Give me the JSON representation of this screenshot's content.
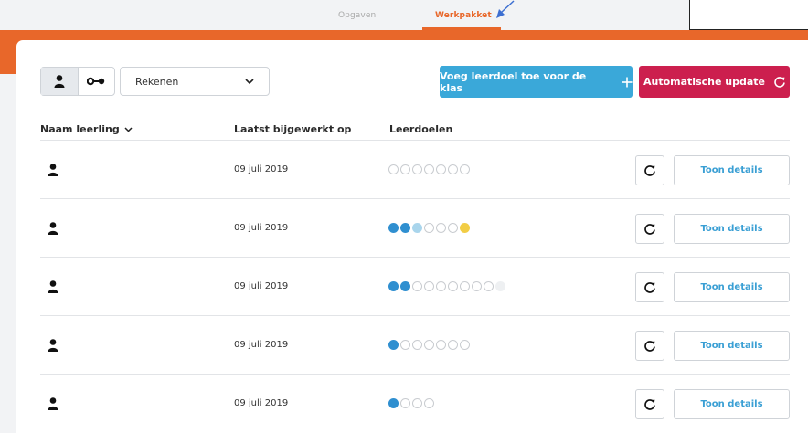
{
  "tabs": {
    "opgaven": "Opgaven",
    "werkpakket": "Werkpakket"
  },
  "toolbar": {
    "subject_select": "Rekenen",
    "add_goal_label": "Voeg leerdoel toe voor de klas",
    "auto_update_label": "Automatische update"
  },
  "table": {
    "headers": {
      "name": "Naam leerling",
      "date": "Laatst bijgewerkt op",
      "goals": "Leerdoelen"
    },
    "rows": [
      {
        "date": "09 juli 2019",
        "goals": [
          "empty",
          "empty",
          "empty",
          "empty",
          "empty",
          "empty",
          "empty"
        ],
        "details_label": "Toon details"
      },
      {
        "date": "09 juli 2019",
        "goals": [
          "done",
          "done",
          "partial",
          "empty",
          "empty",
          "empty",
          "star"
        ],
        "details_label": "Toon details"
      },
      {
        "date": "09 juli 2019",
        "goals": [
          "done",
          "done",
          "empty",
          "empty",
          "empty",
          "empty",
          "empty",
          "empty",
          "empty",
          "faint"
        ],
        "details_label": "Toon details"
      },
      {
        "date": "09 juli 2019",
        "goals": [
          "done",
          "empty",
          "empty",
          "empty",
          "empty",
          "empty",
          "empty"
        ],
        "details_label": "Toon details"
      },
      {
        "date": "09 juli 2019",
        "goals": [
          "done",
          "empty",
          "empty",
          "empty"
        ],
        "details_label": "Toon details"
      }
    ]
  },
  "colors": {
    "accent_orange": "#e8672a",
    "add_button": "#3aa8d9",
    "auto_update_button": "#cc1f4e",
    "goal_done": "#2f8fd0",
    "goal_partial": "#a9d5ec",
    "goal_star": "#f2cd45"
  },
  "icons": {
    "toggle_student": "person-icon",
    "toggle_link": "link-icon",
    "select": "chevron-down-icon",
    "add": "plus-icon",
    "auto_update": "refresh-icon",
    "row_refresh": "refresh-icon",
    "sort": "chevron-down-icon"
  }
}
